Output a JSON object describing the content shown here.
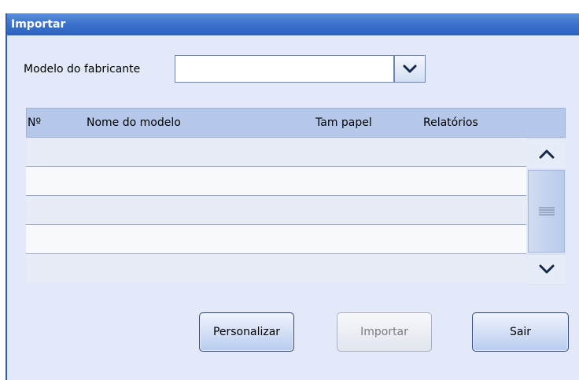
{
  "window": {
    "title": "Importar"
  },
  "model_selector": {
    "label": "Modelo do fabricante",
    "value": ""
  },
  "table": {
    "columns": [
      "Nº",
      "Nome do modelo",
      "Tam papel",
      "Relatórios"
    ],
    "rows": []
  },
  "buttons": {
    "customize": "Personalizar",
    "import": "Importar",
    "exit": "Sair"
  },
  "colors": {
    "titlebar": "#3b73cf",
    "window_bg": "#e3e9f8",
    "header_bg": "#b6c8ea"
  }
}
